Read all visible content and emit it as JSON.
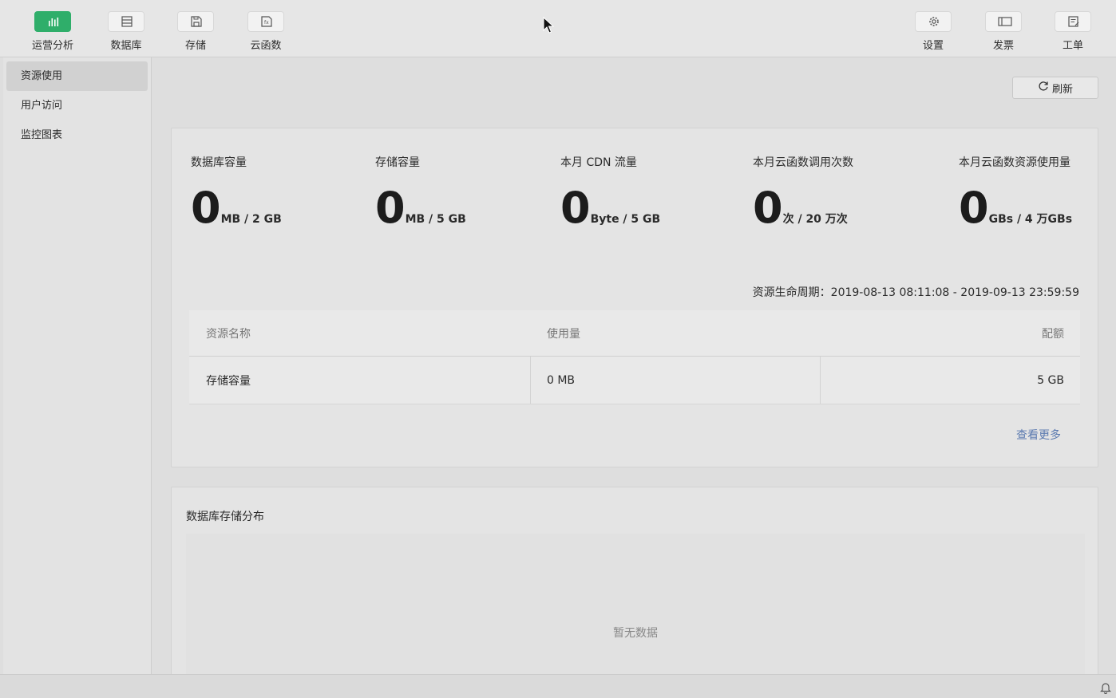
{
  "toolbar": {
    "left_items": [
      {
        "label": "运营分析",
        "icon": "bar-chart-icon",
        "active": true
      },
      {
        "label": "数据库",
        "icon": "database-icon"
      },
      {
        "label": "存储",
        "icon": "storage-icon"
      },
      {
        "label": "云函数",
        "icon": "cloud-function-icon"
      }
    ],
    "right_items": [
      {
        "label": "设置",
        "icon": "gear-icon"
      },
      {
        "label": "发票",
        "icon": "invoice-icon"
      },
      {
        "label": "工单",
        "icon": "ticket-icon"
      }
    ]
  },
  "sidebar": {
    "items": [
      {
        "label": "资源使用",
        "active": true
      },
      {
        "label": "用户访问"
      },
      {
        "label": "监控图表"
      }
    ]
  },
  "main": {
    "refresh_label": "刷新",
    "metrics": [
      {
        "title": "数据库容量",
        "value": "0",
        "unit": "MB / 2 GB"
      },
      {
        "title": "存储容量",
        "value": "0",
        "unit": "MB / 5 GB"
      },
      {
        "title": "本月 CDN 流量",
        "value": "0",
        "unit": "Byte / 5 GB"
      },
      {
        "title": "本月云函数调用次数",
        "value": "0",
        "unit": "次 / 20 万次"
      },
      {
        "title": "本月云函数资源使用量",
        "value": "0",
        "unit": "GBs / 4 万GBs"
      }
    ],
    "lifecycle": "资源生命周期：2019-08-13 08:11:08 - 2019-09-13 23:59:59",
    "table": {
      "headers": [
        "资源名称",
        "使用量",
        "配额"
      ],
      "rows": [
        [
          "存储容量",
          "0 MB",
          "5 GB"
        ]
      ]
    },
    "more_link": "查看更多",
    "db_dist_title": "数据库存储分布",
    "empty_text": "暂无数据"
  },
  "colors": {
    "accent": "#2fae6a",
    "link": "#5b7ab0"
  }
}
